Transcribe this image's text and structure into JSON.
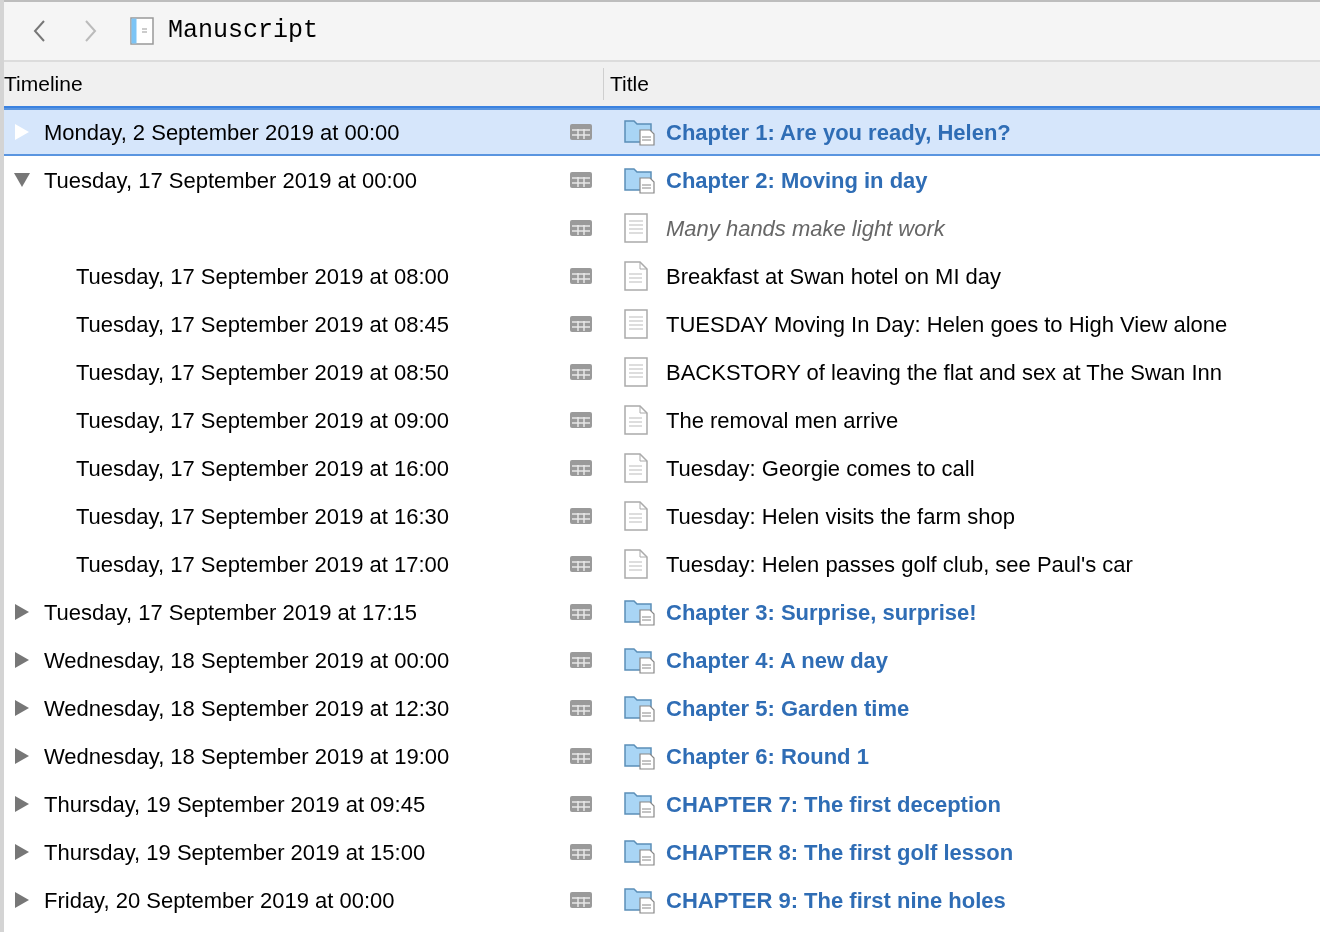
{
  "toolbar": {
    "title": "Manuscript"
  },
  "columns": [
    "Timeline",
    "Title"
  ],
  "rows": [
    {
      "kind": "chapter",
      "date": "Monday, 2 September 2019 at 00:00",
      "title": "Chapter 1: Are you ready, Helen?",
      "selected": true,
      "expanded": false
    },
    {
      "kind": "chapter",
      "date": "Tuesday, 17 September 2019 at 00:00",
      "title": "Chapter 2: Moving in day",
      "selected": false,
      "expanded": true,
      "children": [
        {
          "kind": "note",
          "title": "Many hands make light work",
          "selected": false
        },
        {
          "kind": "scene",
          "date": "Tuesday, 17 September 2019 at 08:00",
          "title": "Breakfast at Swan hotel on MI day",
          "selected": false
        },
        {
          "kind": "text",
          "date": "Tuesday, 17 September 2019 at 08:45",
          "title": "TUESDAY Moving In Day: Helen goes to High View alone",
          "selected": false
        },
        {
          "kind": "text",
          "date": "Tuesday, 17 September 2019 at 08:50",
          "title": "BACKSTORY of leaving the flat and sex at The Swan Inn",
          "selected": false
        },
        {
          "kind": "scene",
          "date": "Tuesday, 17 September 2019 at 09:00",
          "title": "The removal men arrive",
          "selected": false
        },
        {
          "kind": "scene",
          "date": "Tuesday, 17 September 2019 at 16:00",
          "title": "Tuesday: Georgie comes to call",
          "selected": false
        },
        {
          "kind": "scene",
          "date": "Tuesday, 17 September 2019 at 16:30",
          "title": "Tuesday: Helen visits the farm shop",
          "selected": false
        },
        {
          "kind": "scene",
          "date": "Tuesday, 17 September 2019 at 17:00",
          "title": "Tuesday: Helen passes golf club, see Paul's car",
          "selected": false
        }
      ]
    },
    {
      "kind": "chapter",
      "date": "Tuesday, 17 September 2019 at 17:15",
      "title": "Chapter 3: Surprise, surprise!",
      "selected": false,
      "expanded": false
    },
    {
      "kind": "chapter",
      "date": "Wednesday, 18 September 2019 at 00:00",
      "title": "Chapter 4: A new day",
      "selected": false,
      "expanded": false
    },
    {
      "kind": "chapter",
      "date": "Wednesday, 18 September 2019 at 12:30",
      "title": "Chapter 5: Garden time",
      "selected": false,
      "expanded": false
    },
    {
      "kind": "chapter",
      "date": "Wednesday, 18 September 2019 at 19:00",
      "title": "Chapter 6: Round 1",
      "selected": false,
      "expanded": false
    },
    {
      "kind": "chapter",
      "date": "Thursday, 19 September 2019 at 09:45",
      "title": "CHAPTER 7: The first deception",
      "selected": false,
      "expanded": false
    },
    {
      "kind": "chapter",
      "date": "Thursday, 19 September 2019 at 15:00",
      "title": "CHAPTER 8: The first golf lesson",
      "selected": false,
      "expanded": false
    },
    {
      "kind": "chapter",
      "date": "Friday, 20 September 2019 at 00:00",
      "title": "CHAPTER 9: The first nine holes",
      "selected": false,
      "expanded": false
    }
  ]
}
